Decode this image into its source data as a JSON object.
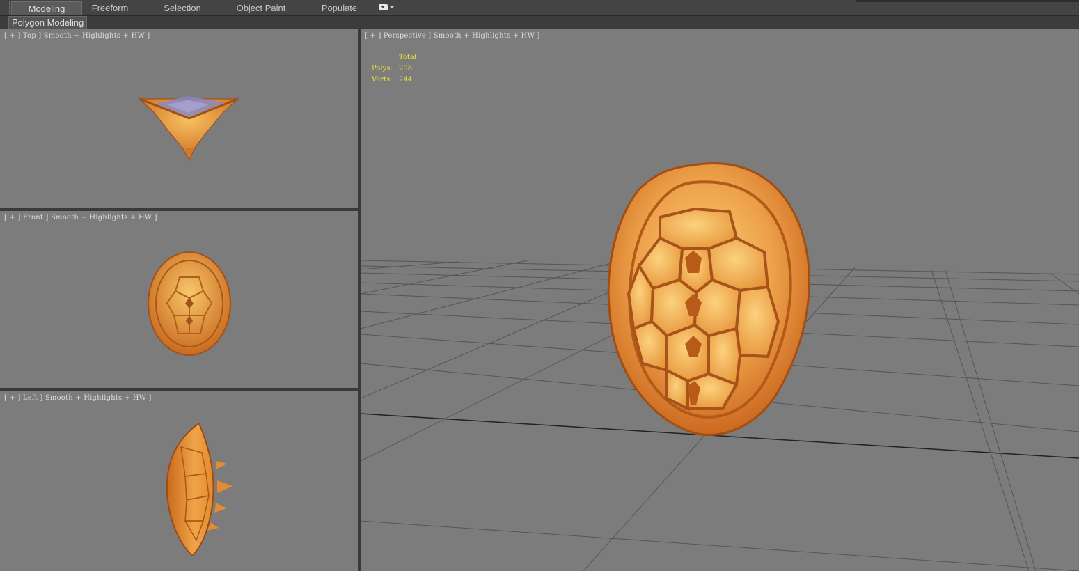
{
  "ribbon": {
    "tabs": [
      "Modeling",
      "Freeform",
      "Selection",
      "Object Paint",
      "Populate"
    ],
    "active_tab": "Modeling",
    "panel_label": "Polygon Modeling"
  },
  "viewports": {
    "top": {
      "label_parts": [
        "[",
        "+",
        "]",
        "Top",
        "]",
        "Smooth + Highlights + HW",
        "]"
      ],
      "label": "[ + ] Top ] Smooth + Highlights + HW ]"
    },
    "front": {
      "label": "[ + ] Front ] Smooth + Highlights + HW ]"
    },
    "left": {
      "label": "[ + ] Left ] Smooth + Highlights + HW ]"
    },
    "perspective": {
      "label": "[ + ] Perspective ] Smooth + Highlights + HW ]"
    }
  },
  "stats": {
    "header": "Total",
    "polys_label": "Polys:",
    "polys_value": "298",
    "verts_label": "Verts:",
    "verts_value": "244"
  },
  "colors": {
    "viewport_bg": "#7c7c7c",
    "stats_text": "#e8e23a",
    "shell_orange": "#e08a2a",
    "shell_highlight": "#f6c060"
  }
}
